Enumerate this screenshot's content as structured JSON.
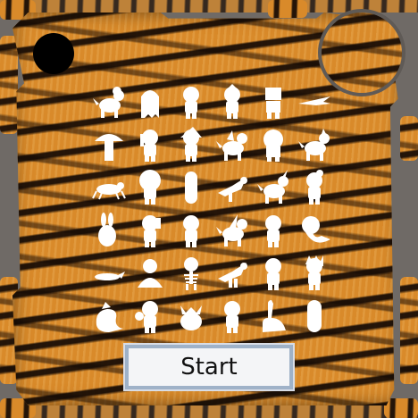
{
  "start_button": {
    "label": "Start"
  },
  "colors": {
    "frame": "#6f6a66",
    "tiger_orange": "#d98a2a",
    "stripe": "#140a05",
    "silhouette": "#ffffff",
    "button_border": "#9fb2c8"
  },
  "grid": {
    "rows": 6,
    "cols": 6,
    "pieces": [
      [
        "pony-icon",
        "ghost-icon",
        "kid-icon",
        "flame-kid-icon",
        "robot-icon",
        "dragonfly-icon"
      ],
      [
        "mushroom-icon",
        "girl-icon",
        "witch-icon",
        "dragon-baby-icon",
        "lion-icon",
        "wolf-icon"
      ],
      [
        "spider-icon",
        "bighair-kid-icon",
        "pillar-kid-icon",
        "bird-icon",
        "unicorn-icon",
        "curly-kid-icon"
      ],
      [
        "bunny-icon",
        "ponytail-kid-icon",
        "round-kid-icon",
        "pegasus-icon",
        "pants-kid-icon",
        "mermaid-icon"
      ],
      [
        "lizard-icon",
        "bust-icon",
        "skeleton-icon",
        "dino-icon",
        "hooded-kid-icon",
        "spiky-kid-icon"
      ],
      [
        "sea-dragon-icon",
        "boxer-icon",
        "moose-icon",
        "baby-icon",
        "dino-neck-icon",
        "capsule-kid-icon"
      ]
    ]
  }
}
